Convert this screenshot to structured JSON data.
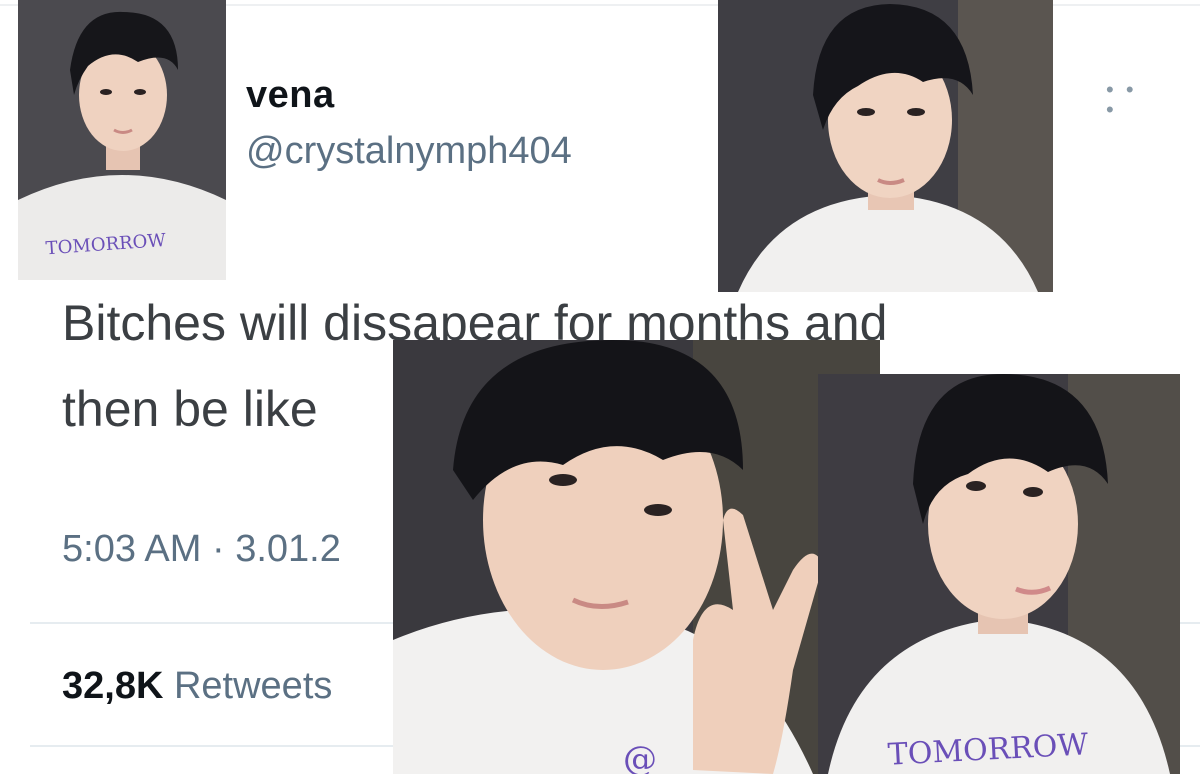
{
  "tweet": {
    "display_name": "vena",
    "handle": "@crystalnymph404",
    "text_line1": "Bitches will dissapear for months and",
    "text_line2": "then be like",
    "timestamp": "5:03 AM · 3.01.2",
    "retweet_count": "32,8K",
    "retweet_label": "Retweets",
    "more_icon": "more-horizontal-icon"
  },
  "photos": [
    {
      "shirt_text": "TOMORROW"
    },
    {
      "shirt_text": ""
    },
    {
      "shirt_text": ""
    },
    {
      "shirt_text": "TOMORROW"
    }
  ],
  "colors": {
    "shirt_print": "#6a4fb8",
    "handle_gray": "#5b7083"
  }
}
